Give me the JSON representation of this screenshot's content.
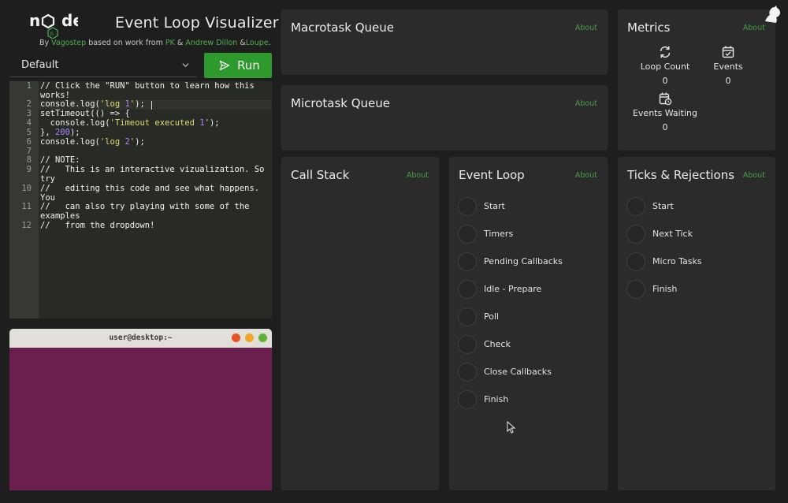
{
  "header": {
    "title": "Event Loop Visualizer",
    "byline": {
      "by": "By",
      "author": "Vagostep",
      "based": "based on work from",
      "credit1": "PK",
      "amp1": "&",
      "credit2": "Andrew Dillon",
      "amp2": "&",
      "credit3": "Loupe",
      "dot": "."
    },
    "logo_icon": "nodejs-logo"
  },
  "toolbar": {
    "example_select_value": "Default",
    "run_label": "Run"
  },
  "editor": {
    "lines": [
      {
        "n": "1",
        "text": "// Click the \"RUN\" button to learn how this works!"
      },
      {
        "n": "2",
        "text": "console.log('log 1');"
      },
      {
        "n": "3",
        "text": "setTimeout(() => {"
      },
      {
        "n": "4",
        "text": "  console.log('Timeout executed 1');"
      },
      {
        "n": "5",
        "text": "}, 200);"
      },
      {
        "n": "6",
        "text": "console.log('log 2');"
      },
      {
        "n": "7",
        "text": ""
      },
      {
        "n": "8",
        "text": "// NOTE:"
      },
      {
        "n": "9",
        "text": "//   This is an interactive vizualization. So try"
      },
      {
        "n": "10",
        "text": "//   editing this code and see what happens. You"
      },
      {
        "n": "11",
        "text": "//   can also try playing with some of the examples"
      },
      {
        "n": "12",
        "text": "//   from the dropdown!"
      }
    ]
  },
  "terminal": {
    "title": "user@desktop:~",
    "colors": {
      "close": "#e95420",
      "minimize": "#f5a623",
      "maximize": "#5fb236",
      "background": "#6a1f4e"
    }
  },
  "panels": {
    "about_label": "About",
    "macrotask": {
      "title": "Macrotask Queue"
    },
    "microtask": {
      "title": "Microtask Queue"
    },
    "callstack": {
      "title": "Call Stack"
    },
    "eventloop": {
      "title": "Event Loop",
      "steps": [
        "Start",
        "Timers",
        "Pending Callbacks",
        "Idle - Prepare",
        "Poll",
        "Check",
        "Close Callbacks",
        "Finish"
      ]
    },
    "ticks": {
      "title": "Ticks & Rejections",
      "steps": [
        "Start",
        "Next Tick",
        "Micro Tasks",
        "Finish"
      ]
    },
    "metrics": {
      "title": "Metrics",
      "items": [
        {
          "label": "Loop Count",
          "value": "0",
          "icon": "refresh-icon"
        },
        {
          "label": "Events",
          "value": "0",
          "icon": "calendar-check-icon"
        },
        {
          "label": "Events Waiting",
          "value": "0",
          "icon": "calendar-clock-icon"
        }
      ]
    }
  },
  "theme": {
    "accent": "#43a047",
    "run_button": "#2e9a2e",
    "panel_bg": "#2b2b2b",
    "page_bg": "#1e1e1e"
  }
}
